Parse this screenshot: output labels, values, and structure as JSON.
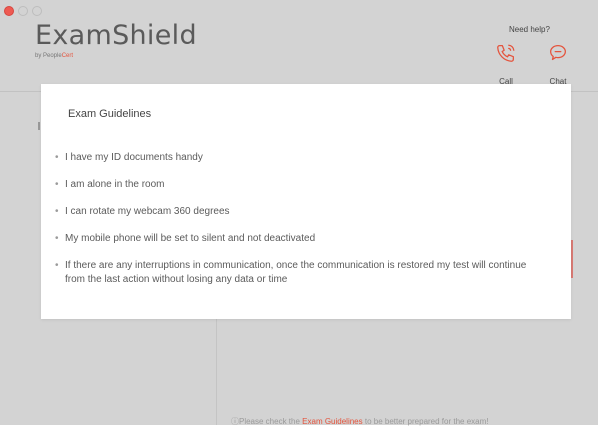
{
  "app": {
    "brand_title": "ExamShield",
    "brand_sub_prefix": "by People",
    "brand_sub_accent": "Cert"
  },
  "header": {
    "help_label": "Need help?",
    "call_label": "Call",
    "chat_label": "Chat",
    "call_icon": "phone-icon",
    "chat_icon": "chat-bubble-icon"
  },
  "modal": {
    "title": "Exam Guidelines",
    "items": [
      "I have my ID documents handy",
      "I am alone in the room",
      "I can rotate my webcam 360 degrees",
      "My mobile phone will be set to silent and not deactivated",
      "If there are any interruptions in communication, once the communication is restored my test will continue from the last action without losing any data or time"
    ]
  },
  "footer": {
    "info_icon": "info-icon",
    "prefix": "ⓘPlease check the ",
    "link": "Exam Guidelines",
    "suffix": " to be better prepared for the exam!"
  },
  "colors": {
    "accent": "#e4543d",
    "backdrop": "#d3d3d3"
  }
}
